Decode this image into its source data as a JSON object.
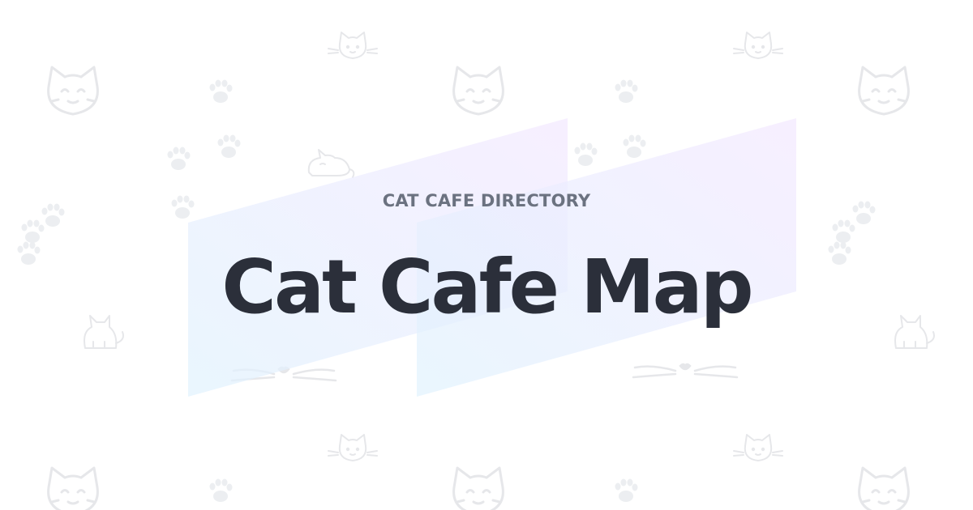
{
  "card": {
    "eyebrow": "CAT CAFE DIRECTORY",
    "title": "Cat Cafe Map"
  },
  "colors": {
    "background": "#ffffff",
    "eyebrow": "#6b7280",
    "title": "#2b2f3a",
    "ribbon_start": "#e0f2fe",
    "ribbon_end": "#f3e8ff",
    "pattern": "#e5e7eb"
  },
  "decorations": {
    "pattern_icons": [
      "cat-face-icon",
      "cat-head-icon",
      "paw-prints-icon",
      "cat-whiskers-icon",
      "sleeping-cat-icon",
      "sitting-cat-icon"
    ]
  }
}
